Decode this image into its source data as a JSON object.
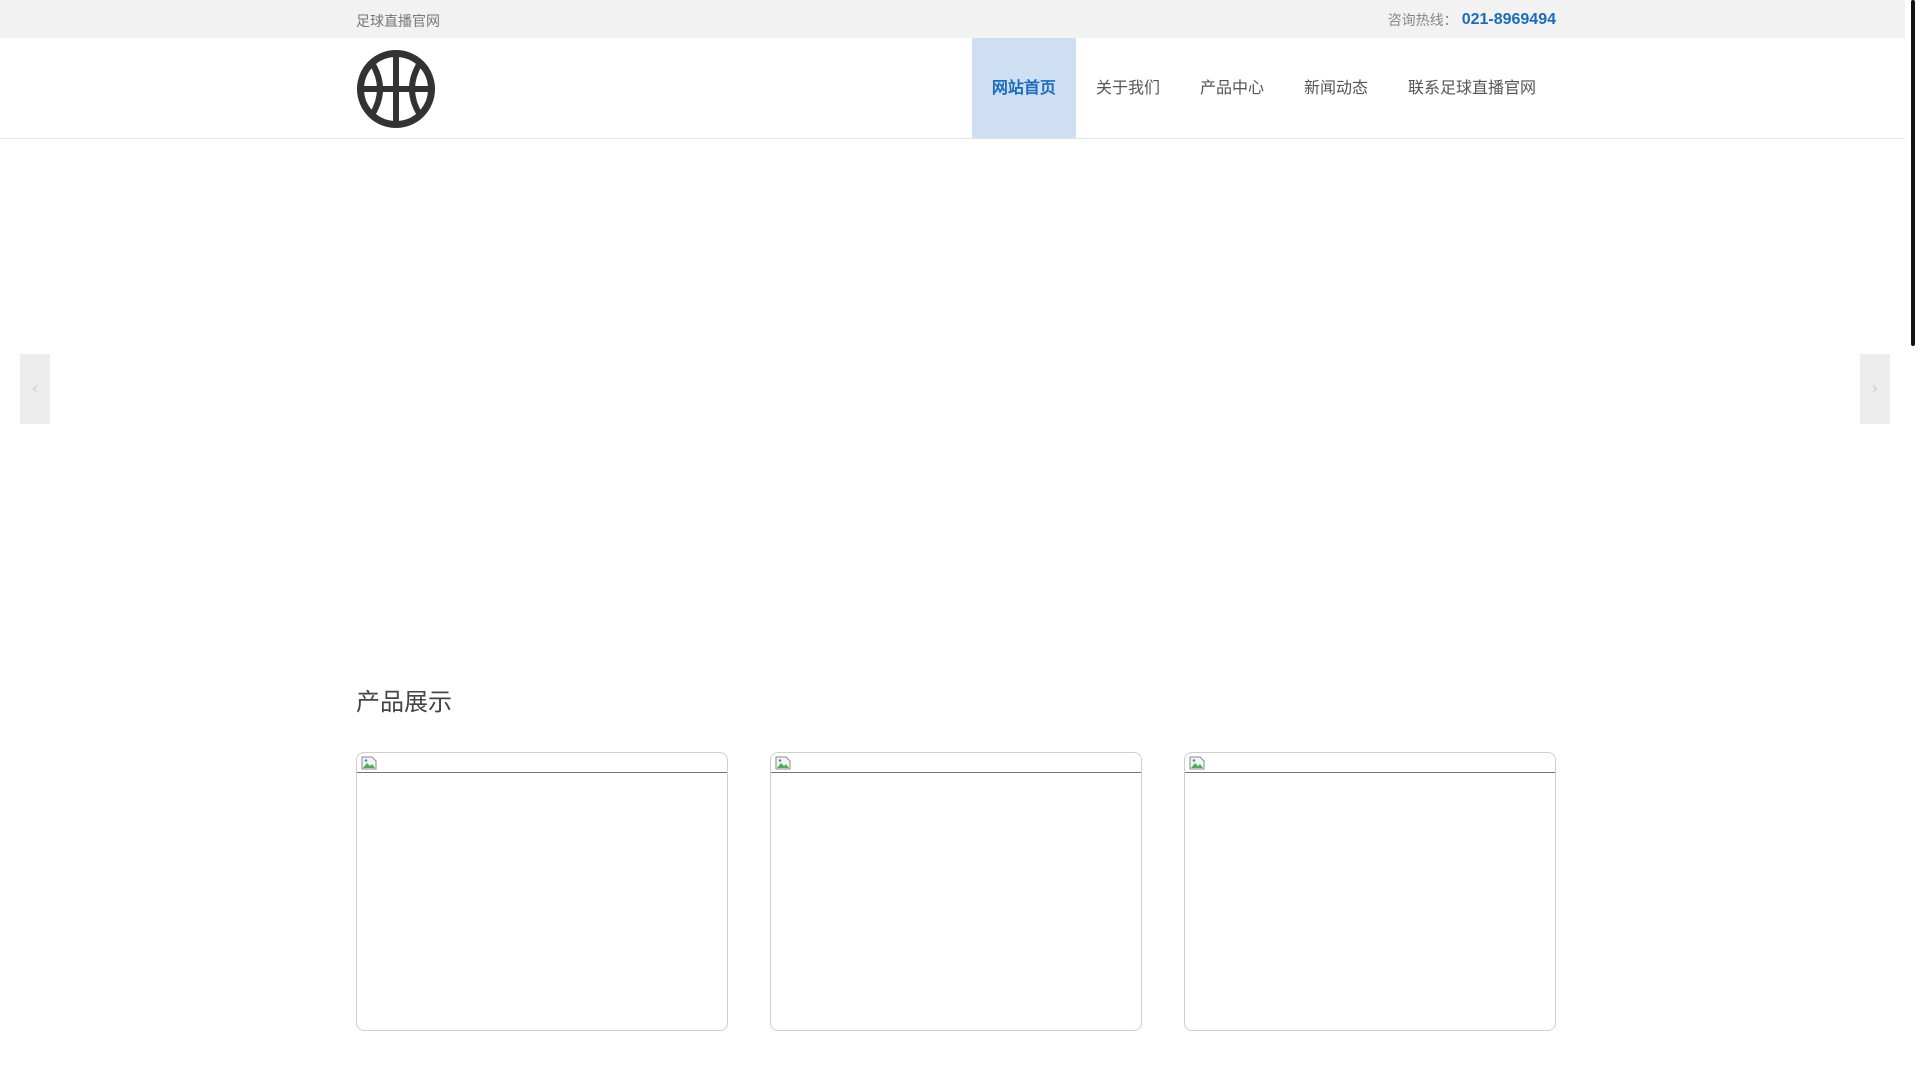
{
  "topbar": {
    "site_name": "足球直播官网",
    "hotline_label": "咨询热线：",
    "hotline_number": "021-8969494"
  },
  "header": {
    "logo_icon": "basketball-icon",
    "nav": [
      {
        "label": "网站首页",
        "active": true
      },
      {
        "label": "关于我们",
        "active": false
      },
      {
        "label": "产品中心",
        "active": false
      },
      {
        "label": "新闻动态",
        "active": false
      },
      {
        "label": "联系足球直播官网",
        "active": false
      }
    ]
  },
  "banner": {
    "prev_arrow": "‹",
    "next_arrow": "›"
  },
  "products": {
    "title": "产品展示",
    "items": [
      {
        "icon": "broken-image-icon"
      },
      {
        "icon": "broken-image-icon"
      },
      {
        "icon": "broken-image-icon"
      }
    ]
  },
  "colors": {
    "accent": "#1a6bbf",
    "nav_active_bg": "#cfdff3",
    "topbar_bg": "#f2f2f2"
  }
}
